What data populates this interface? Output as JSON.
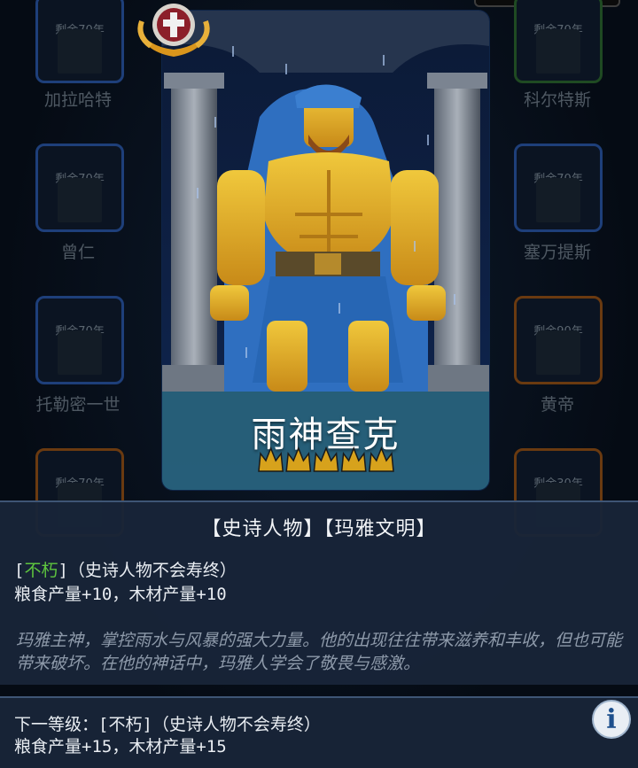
{
  "background": {
    "cards": [
      {
        "remain": "剩余70年",
        "name": "加拉哈特"
      },
      {
        "remain": "剩余70年",
        "name": "科尔特斯"
      },
      {
        "remain": "剩余70年",
        "name": "曾仁"
      },
      {
        "remain": "剩余70年",
        "name": "塞万提斯"
      },
      {
        "remain": "剩余70年",
        "name": "托勒密一世"
      },
      {
        "remain": "剩余90年",
        "name": "黄帝"
      },
      {
        "remain": "剩余70年",
        "name": ""
      },
      {
        "remain": "剩余30年",
        "name": ""
      }
    ]
  },
  "character": {
    "name": "雨神查克",
    "stars": 5,
    "emblem_icon": "cross-laurel-emblem-icon"
  },
  "panel": {
    "tags": "【史诗人物】【玛雅文明】",
    "trait_open": "[",
    "trait_name": "不朽",
    "trait_close": "]（史诗人物不会寿终）",
    "bonus": "粮食产量+10，木材产量+10",
    "description": "玛雅主神，掌控雨水与风暴的强大力量。他的出现往往带来滋养和丰收，但也可能带来破坏。在他的神话中，玛雅人学会了敬畏与感激。"
  },
  "next_level": {
    "line1": "下一等级：[不朽]（史诗人物不会寿终）",
    "line2": "粮食产量+15，木材产量+15",
    "info_label": "i"
  },
  "colors": {
    "accent_green": "#5ec43f",
    "crown_gold": "#d7a21c",
    "panel_bg": "#182438"
  }
}
